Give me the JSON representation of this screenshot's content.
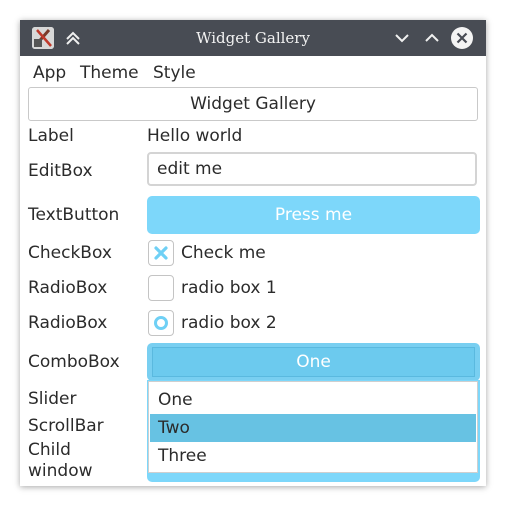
{
  "window": {
    "title": "Widget Gallery"
  },
  "menubar": {
    "items": [
      "App",
      "Theme",
      "Style"
    ]
  },
  "header_button": {
    "label": "Widget Gallery"
  },
  "rows": {
    "label": {
      "label": "Label",
      "value": "Hello world"
    },
    "editbox": {
      "label": "EditBox",
      "value": "edit me"
    },
    "textbutton": {
      "label": "TextButton",
      "button_label": "Press me"
    },
    "checkbox": {
      "label": "CheckBox",
      "option_label": "Check me",
      "checked": true
    },
    "radio1": {
      "label": "RadioBox",
      "option_label": "radio box 1",
      "selected": false
    },
    "radio2": {
      "label": "RadioBox",
      "option_label": "radio box 2",
      "selected": true
    },
    "combobox": {
      "label": "ComboBox",
      "value": "One",
      "options": [
        "One",
        "Two",
        "Three"
      ],
      "highlighted": "Two"
    },
    "slider": {
      "label": "Slider"
    },
    "scrollbar": {
      "label": "ScrollBar"
    },
    "childwindow": {
      "label_line1": "Child",
      "label_line2": "window"
    }
  },
  "colors": {
    "accent": "#7dd7fa",
    "accent_dark": "#67c2e3",
    "titlebar": "#484c54"
  },
  "icons": [
    "app-icon",
    "shade-icon",
    "minimize-icon",
    "maximize-icon",
    "close-icon",
    "check-icon",
    "radio-dot-icon"
  ]
}
